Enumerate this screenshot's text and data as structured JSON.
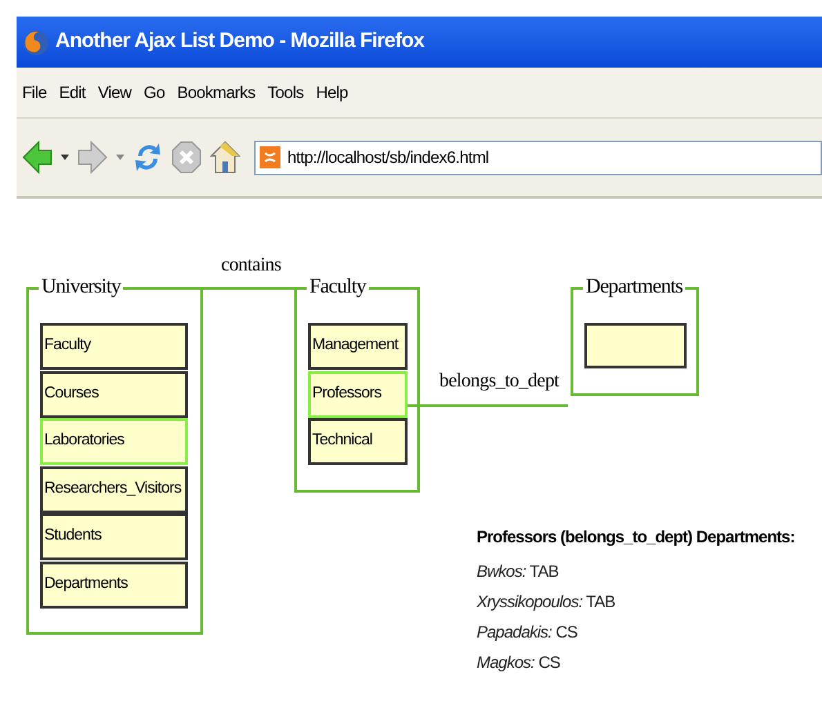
{
  "window": {
    "title": "Another Ajax List Demo - Mozilla Firefox"
  },
  "menu": [
    "File",
    "Edit",
    "View",
    "Go",
    "Bookmarks",
    "Tools",
    "Help"
  ],
  "address_bar": {
    "value": "http://localhost/sb/index6.html"
  },
  "diagram": {
    "lists": [
      {
        "title": "University",
        "items": [
          {
            "label": "Faculty",
            "selected": false
          },
          {
            "label": "Courses",
            "selected": false
          },
          {
            "label": "Laboratories",
            "selected": true
          },
          {
            "label": "Researchers_Visitors",
            "selected": false
          },
          {
            "label": "Students",
            "selected": false
          },
          {
            "label": "Departments",
            "selected": false
          }
        ]
      },
      {
        "title": "Faculty",
        "items": [
          {
            "label": "Management",
            "selected": false
          },
          {
            "label": "Professors",
            "selected": true
          },
          {
            "label": "Technical",
            "selected": false
          }
        ]
      },
      {
        "title": "Departments"
      }
    ],
    "relations": [
      {
        "label": "contains"
      },
      {
        "label": "belongs_to_dept"
      }
    ]
  },
  "result": {
    "heading": "Professors (belongs_to_dept) Departments:",
    "entries": [
      "*Bwkos:* TAB",
      "*Xryssikopoulos:* TAB",
      "*Papadakis:* CS",
      "*Magkos:* CS"
    ]
  }
}
